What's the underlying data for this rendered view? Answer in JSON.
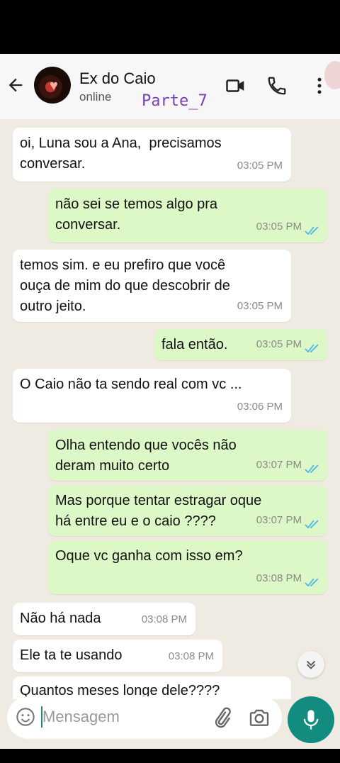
{
  "header": {
    "contact_name": "Ex do Caio",
    "status": "online",
    "overlay_label": "Parte_7",
    "icons": [
      "back-arrow-icon",
      "video-call-icon",
      "phone-icon",
      "more-options-icon"
    ]
  },
  "messages": [
    {
      "dir": "in",
      "text": "oi, Luna sou a Ana,  precisamos\nconversar.",
      "time": "03:05 PM"
    },
    {
      "dir": "out",
      "text": "não sei se temos algo pra\nconversar.",
      "time": "03:05 PM",
      "read": true
    },
    {
      "dir": "in",
      "text": "temos sim. e eu prefiro que você\nouça de mim do que descobrir de\noutro jeito.",
      "time": "03:05 PM"
    },
    {
      "dir": "out",
      "text": "fala então.",
      "time": "03:05 PM",
      "read": true
    },
    {
      "dir": "in",
      "text": "O Caio não ta sendo real com vc ...",
      "time": "03:06 PM"
    },
    {
      "dir": "out",
      "text": "Olha entendo que vocês não\nderam muito certo",
      "time": "03:07 PM",
      "read": true
    },
    {
      "dir": "out",
      "text": "Mas porque tentar estragar oque\nhá entre eu e o caio ????",
      "time": "03:07 PM",
      "read": true
    },
    {
      "dir": "out",
      "text": "Oque vc ganha com isso em?",
      "time": "03:08 PM",
      "read": true
    },
    {
      "dir": "in",
      "text": "Não há nada",
      "time": "03:08 PM"
    },
    {
      "dir": "in",
      "text": "Ele ta te usando",
      "time": "03:08 PM"
    },
    {
      "dir": "in",
      "text": "Quantos meses longe dele????",
      "time": ""
    }
  ],
  "composer": {
    "placeholder": "Mensagem",
    "icons": [
      "emoji-icon",
      "attach-icon",
      "camera-icon",
      "mic-icon"
    ]
  },
  "colors": {
    "incoming": "#ffffff",
    "outgoing": "#dcf8c6",
    "accent": "#128c7e",
    "read_check": "#4fb6ec"
  }
}
